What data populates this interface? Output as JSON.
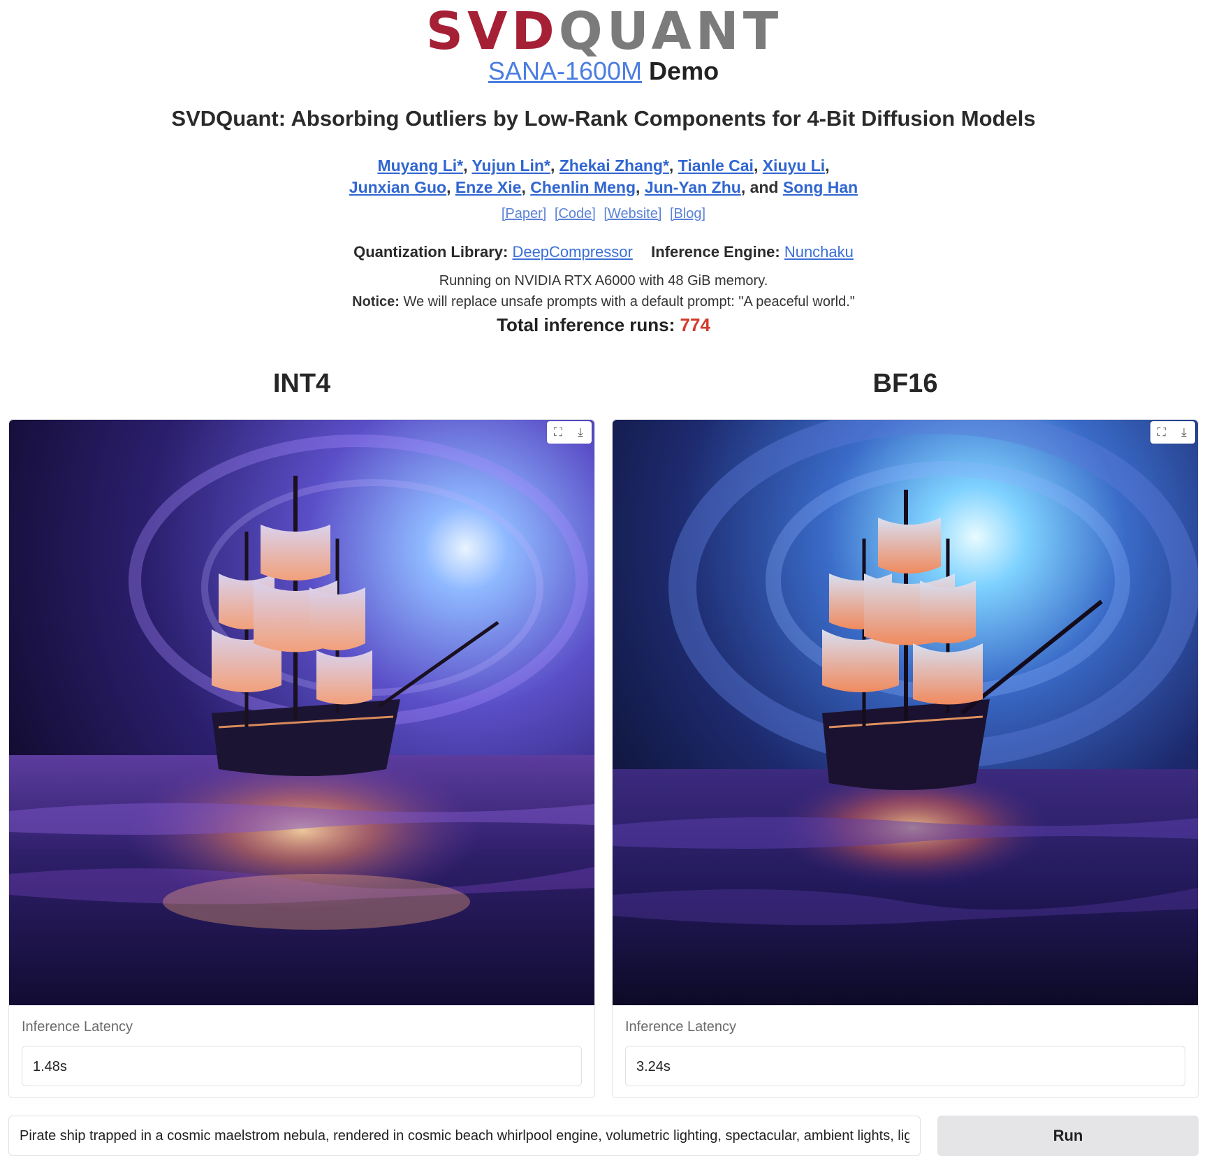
{
  "logo": {
    "part1": "SVD",
    "part2": "QUANT"
  },
  "demo": {
    "model_link": "SANA-1600M",
    "suffix": "Demo"
  },
  "paper_title": "SVDQuant: Absorbing Outliers by Low-Rank Components for 4-Bit Diffusion Models",
  "authors_line1": [
    "Muyang Li*",
    "Yujun Lin*",
    "Zhekai Zhang*",
    "Tianle Cai",
    "Xiuyu Li"
  ],
  "authors_line2": [
    "Junxian Guo",
    "Enze Xie",
    "Chenlin Meng",
    "Jun-Yan Zhu"
  ],
  "authors_last": "Song Han",
  "authors_and": "and",
  "links": [
    "[Paper]",
    "[Code]",
    "[Website]",
    "[Blog]"
  ],
  "library": {
    "quant_label": "Quantization Library:",
    "quant_link": "DeepCompressor",
    "engine_label": "Inference Engine:",
    "engine_link": "Nunchaku"
  },
  "running": "Running on NVIDIA RTX A6000 with 48 GiB memory.",
  "notice": {
    "label": "Notice:",
    "text": "We will replace unsafe prompts with a default prompt: \"A peaceful world.\""
  },
  "runs": {
    "label": "Total inference runs:",
    "count": "774"
  },
  "columns": [
    {
      "title": "INT4",
      "latency_label": "Inference Latency",
      "latency_value": "1.48s"
    },
    {
      "title": "BF16",
      "latency_label": "Inference Latency",
      "latency_value": "3.24s"
    }
  ],
  "toolbar_icons": {
    "fullscreen": "⛶",
    "download": "⤓"
  },
  "prompt": "Pirate ship trapped in a cosmic maelstrom nebula, rendered in cosmic beach whirlpool engine, volumetric lighting, spectacular, ambient lights, light pollution, cinematic atmosphere, art nouveau style",
  "run_button": "Run",
  "colors": {
    "accent_red": "#a62035",
    "link_blue": "#3b6fd6",
    "count_red": "#d33a2c"
  }
}
